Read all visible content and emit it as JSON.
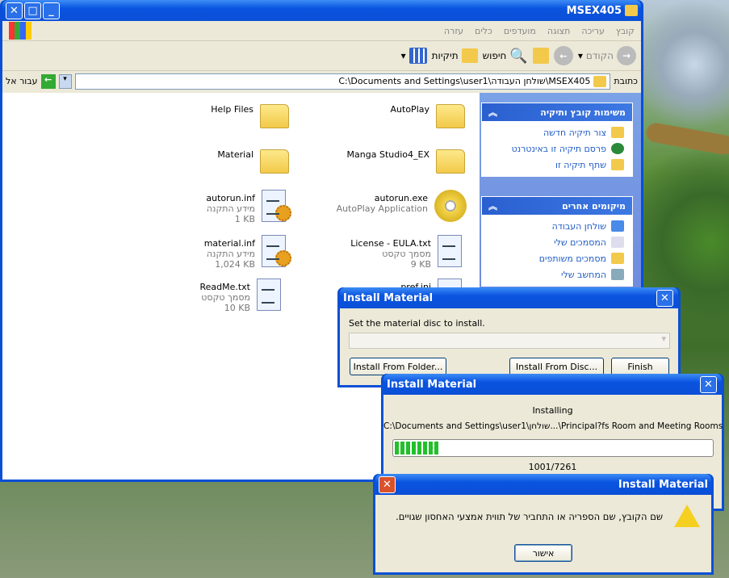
{
  "explorer": {
    "title": "MSEX405",
    "menu": [
      "קובץ",
      "עריכה",
      "תצוגה",
      "מועדפים",
      "כלים",
      "עזרה"
    ],
    "toolbar": {
      "back": "הקודם",
      "search": "חיפוש",
      "folders": "תיקיות"
    },
    "address": {
      "label": "כתובת",
      "value": "C:\\Documents and Settings\\user1\\שולחן העבודה\\MSEX405",
      "go": "עבור אל"
    },
    "tasks": {
      "title": "משימות קובץ ותיקיה",
      "items": [
        "צור תיקיה חדשה",
        "פרסם תיקיה זו באינטרנט",
        "שתף תיקיה זו"
      ]
    },
    "places": {
      "title": "מיקומים אחרים",
      "items": [
        "שולחן העבודה",
        "המסמכים שלי",
        "מסמכים משותפים",
        "המחשב שלי"
      ]
    },
    "files": [
      {
        "name": "AutoPlay",
        "type": "folder"
      },
      {
        "name": "Help Files",
        "type": "folder"
      },
      {
        "name": "Manga Studio4_EX",
        "type": "folder"
      },
      {
        "name": "Material",
        "type": "folder"
      },
      {
        "name": "autorun.exe",
        "desc": "AutoPlay Application",
        "type": "cd"
      },
      {
        "name": "autorun.inf",
        "desc": "מידע התקנה",
        "size": "1 KB",
        "type": "inf"
      },
      {
        "name": "License - EULA.txt",
        "desc": "מסמך טקסט",
        "size": "9 KB",
        "type": "txt"
      },
      {
        "name": "material.inf",
        "desc": "מידע התקנה",
        "size": "1,024 KB",
        "type": "inf"
      },
      {
        "name": "pref.ini",
        "type": "txt"
      },
      {
        "name": "ReadMe.txt",
        "desc": "מסמך טקסט",
        "size": "10 KB",
        "type": "txt"
      }
    ]
  },
  "dialog1": {
    "title": "Install Material",
    "prompt": "Set the material disc to install.",
    "from_folder": "Install From Folder...",
    "from_disc": "Install From Disc...",
    "finish": "Finish"
  },
  "dialog2": {
    "title": "Install Material",
    "status": "Installing",
    "path": "C:\\Documents and Settings\\user1\\שולחן...\\Principal?fs Room and Meeting Rooms",
    "progress_text": "1001/7261",
    "progress": 0.138
  },
  "dialog3": {
    "title": "Install Material",
    "message": "שם הקובץ, שם הספריה או התחביר של תווית אמצעי האחסון שגויים.",
    "ok": "אישור"
  },
  "colors": {
    "titlebar": "#0a4fd6",
    "progress": "#22c02a",
    "link": "#215dc6"
  }
}
